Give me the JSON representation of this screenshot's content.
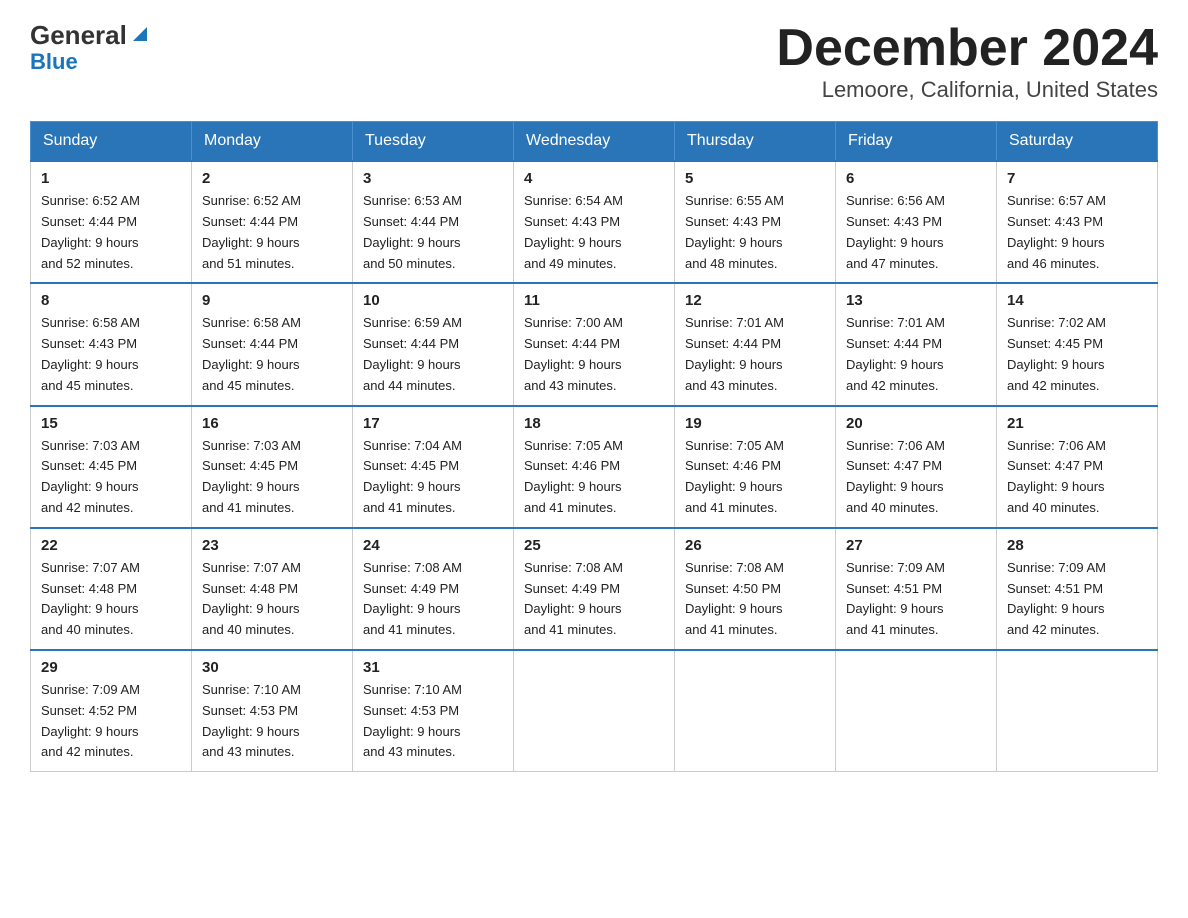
{
  "header": {
    "logo_general": "General",
    "logo_blue": "Blue",
    "title": "December 2024",
    "subtitle": "Lemoore, California, United States"
  },
  "weekdays": [
    "Sunday",
    "Monday",
    "Tuesday",
    "Wednesday",
    "Thursday",
    "Friday",
    "Saturday"
  ],
  "weeks": [
    [
      {
        "day": "1",
        "sunrise": "6:52 AM",
        "sunset": "4:44 PM",
        "daylight": "9 hours and 52 minutes."
      },
      {
        "day": "2",
        "sunrise": "6:52 AM",
        "sunset": "4:44 PM",
        "daylight": "9 hours and 51 minutes."
      },
      {
        "day": "3",
        "sunrise": "6:53 AM",
        "sunset": "4:44 PM",
        "daylight": "9 hours and 50 minutes."
      },
      {
        "day": "4",
        "sunrise": "6:54 AM",
        "sunset": "4:43 PM",
        "daylight": "9 hours and 49 minutes."
      },
      {
        "day": "5",
        "sunrise": "6:55 AM",
        "sunset": "4:43 PM",
        "daylight": "9 hours and 48 minutes."
      },
      {
        "day": "6",
        "sunrise": "6:56 AM",
        "sunset": "4:43 PM",
        "daylight": "9 hours and 47 minutes."
      },
      {
        "day": "7",
        "sunrise": "6:57 AM",
        "sunset": "4:43 PM",
        "daylight": "9 hours and 46 minutes."
      }
    ],
    [
      {
        "day": "8",
        "sunrise": "6:58 AM",
        "sunset": "4:43 PM",
        "daylight": "9 hours and 45 minutes."
      },
      {
        "day": "9",
        "sunrise": "6:58 AM",
        "sunset": "4:44 PM",
        "daylight": "9 hours and 45 minutes."
      },
      {
        "day": "10",
        "sunrise": "6:59 AM",
        "sunset": "4:44 PM",
        "daylight": "9 hours and 44 minutes."
      },
      {
        "day": "11",
        "sunrise": "7:00 AM",
        "sunset": "4:44 PM",
        "daylight": "9 hours and 43 minutes."
      },
      {
        "day": "12",
        "sunrise": "7:01 AM",
        "sunset": "4:44 PM",
        "daylight": "9 hours and 43 minutes."
      },
      {
        "day": "13",
        "sunrise": "7:01 AM",
        "sunset": "4:44 PM",
        "daylight": "9 hours and 42 minutes."
      },
      {
        "day": "14",
        "sunrise": "7:02 AM",
        "sunset": "4:45 PM",
        "daylight": "9 hours and 42 minutes."
      }
    ],
    [
      {
        "day": "15",
        "sunrise": "7:03 AM",
        "sunset": "4:45 PM",
        "daylight": "9 hours and 42 minutes."
      },
      {
        "day": "16",
        "sunrise": "7:03 AM",
        "sunset": "4:45 PM",
        "daylight": "9 hours and 41 minutes."
      },
      {
        "day": "17",
        "sunrise": "7:04 AM",
        "sunset": "4:45 PM",
        "daylight": "9 hours and 41 minutes."
      },
      {
        "day": "18",
        "sunrise": "7:05 AM",
        "sunset": "4:46 PM",
        "daylight": "9 hours and 41 minutes."
      },
      {
        "day": "19",
        "sunrise": "7:05 AM",
        "sunset": "4:46 PM",
        "daylight": "9 hours and 41 minutes."
      },
      {
        "day": "20",
        "sunrise": "7:06 AM",
        "sunset": "4:47 PM",
        "daylight": "9 hours and 40 minutes."
      },
      {
        "day": "21",
        "sunrise": "7:06 AM",
        "sunset": "4:47 PM",
        "daylight": "9 hours and 40 minutes."
      }
    ],
    [
      {
        "day": "22",
        "sunrise": "7:07 AM",
        "sunset": "4:48 PM",
        "daylight": "9 hours and 40 minutes."
      },
      {
        "day": "23",
        "sunrise": "7:07 AM",
        "sunset": "4:48 PM",
        "daylight": "9 hours and 40 minutes."
      },
      {
        "day": "24",
        "sunrise": "7:08 AM",
        "sunset": "4:49 PM",
        "daylight": "9 hours and 41 minutes."
      },
      {
        "day": "25",
        "sunrise": "7:08 AM",
        "sunset": "4:49 PM",
        "daylight": "9 hours and 41 minutes."
      },
      {
        "day": "26",
        "sunrise": "7:08 AM",
        "sunset": "4:50 PM",
        "daylight": "9 hours and 41 minutes."
      },
      {
        "day": "27",
        "sunrise": "7:09 AM",
        "sunset": "4:51 PM",
        "daylight": "9 hours and 41 minutes."
      },
      {
        "day": "28",
        "sunrise": "7:09 AM",
        "sunset": "4:51 PM",
        "daylight": "9 hours and 42 minutes."
      }
    ],
    [
      {
        "day": "29",
        "sunrise": "7:09 AM",
        "sunset": "4:52 PM",
        "daylight": "9 hours and 42 minutes."
      },
      {
        "day": "30",
        "sunrise": "7:10 AM",
        "sunset": "4:53 PM",
        "daylight": "9 hours and 43 minutes."
      },
      {
        "day": "31",
        "sunrise": "7:10 AM",
        "sunset": "4:53 PM",
        "daylight": "9 hours and 43 minutes."
      },
      null,
      null,
      null,
      null
    ]
  ],
  "labels": {
    "sunrise": "Sunrise: ",
    "sunset": "Sunset: ",
    "daylight": "Daylight: "
  }
}
